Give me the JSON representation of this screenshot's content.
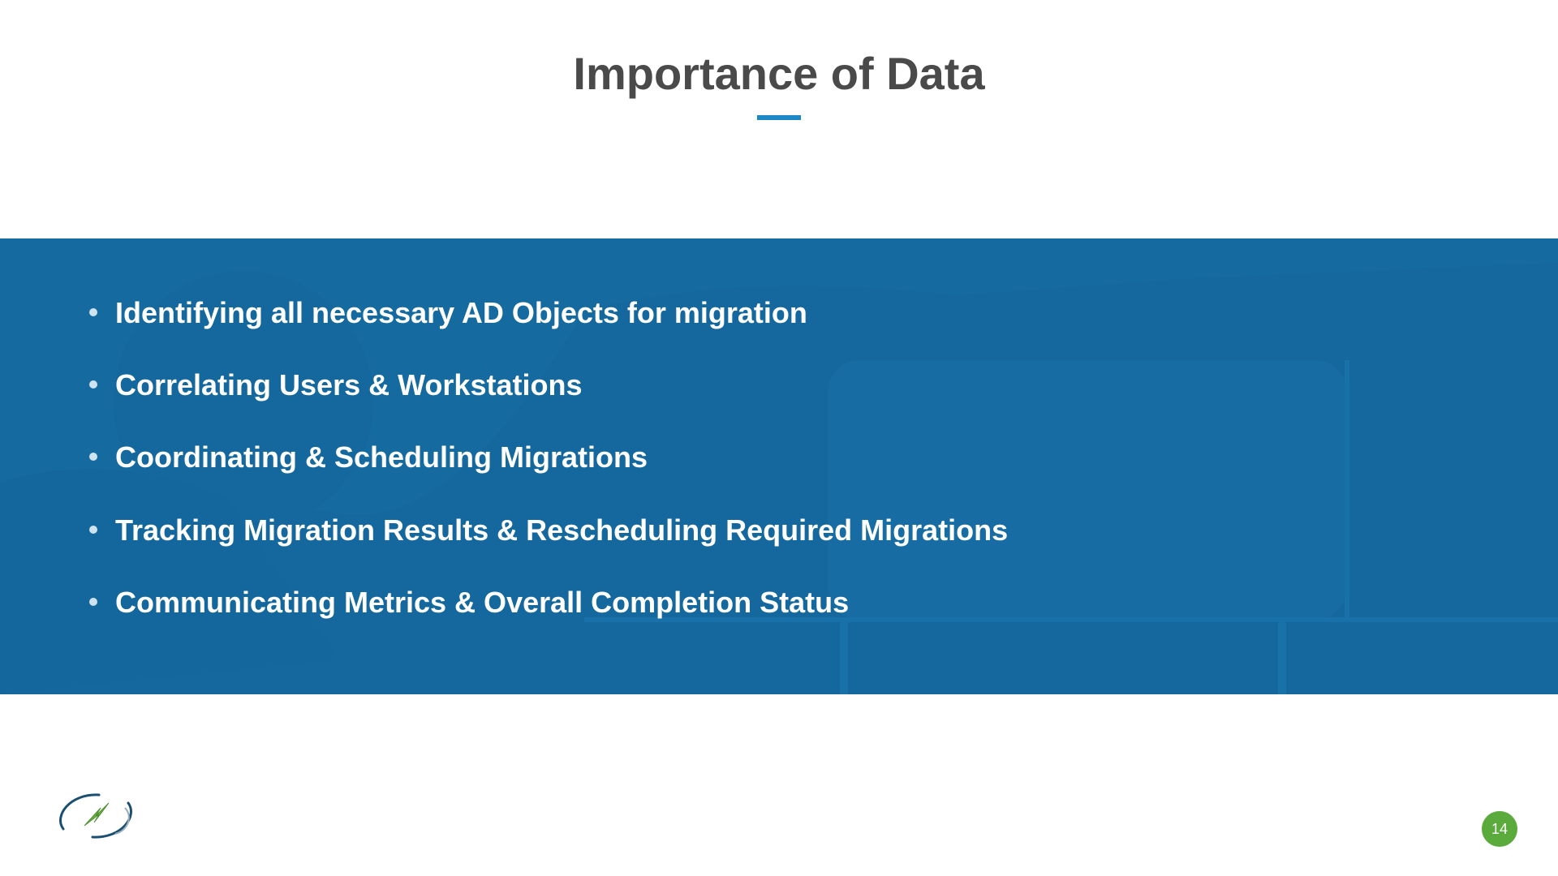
{
  "title": "Importance of Data",
  "bullets": [
    "Identifying all necessary AD Objects for migration",
    "Correlating Users & Workstations",
    "Coordinating & Scheduling Migrations",
    "Tracking Migration Results & Rescheduling Required Migrations",
    "Communicating Metrics & Overall Completion Status"
  ],
  "page_number": "14",
  "colors": {
    "band": "#166fa8",
    "accent": "#1e88c7",
    "badge": "#5aab3b",
    "title_text": "#4a4a4a"
  }
}
